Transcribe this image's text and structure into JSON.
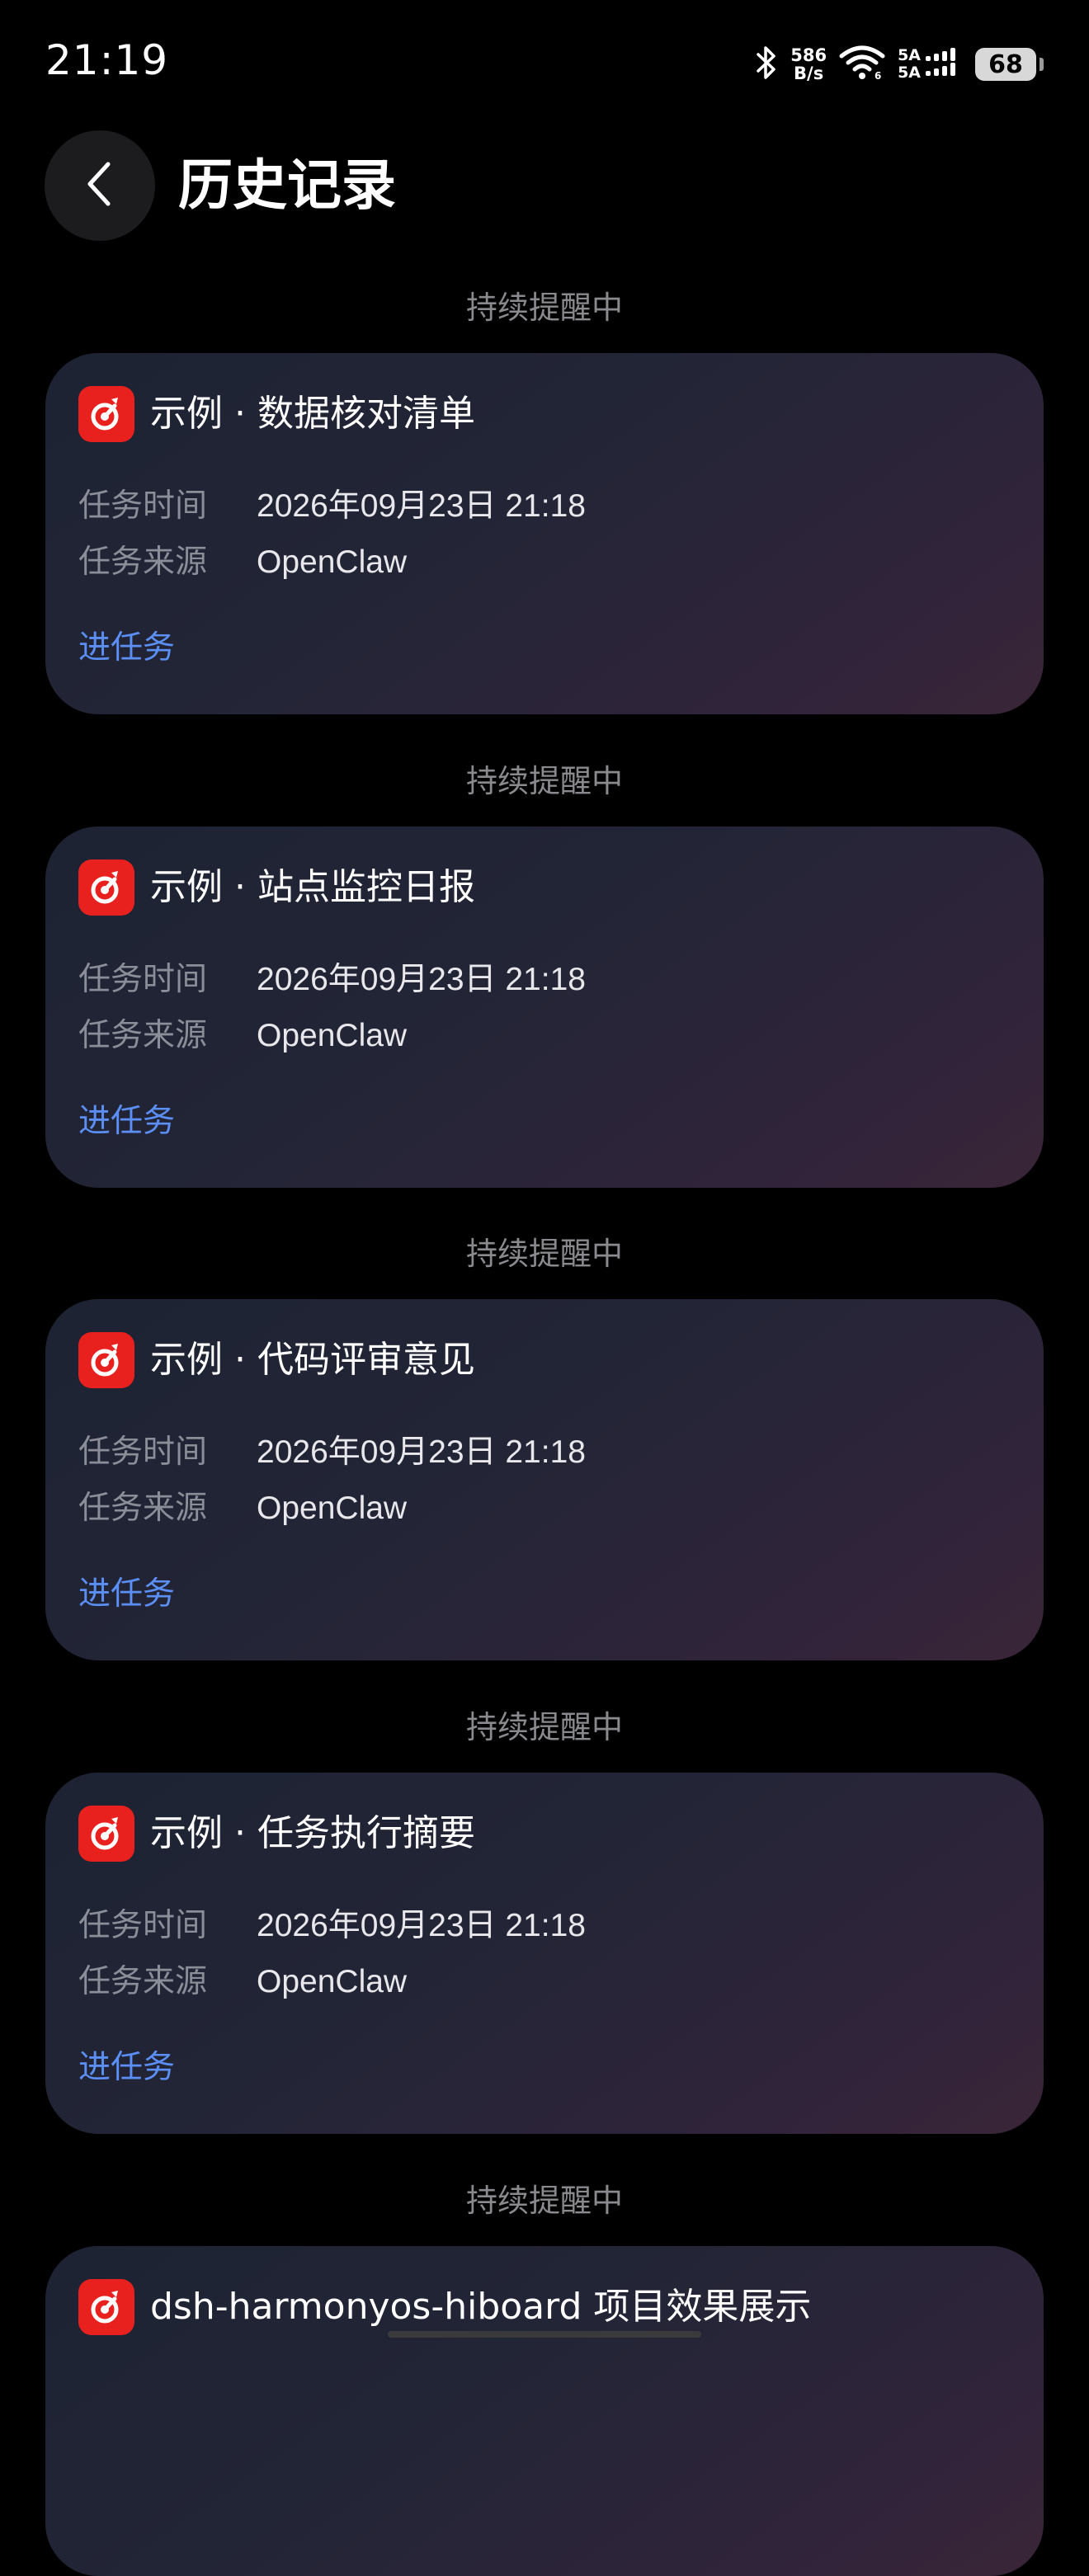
{
  "status_bar": {
    "time": "21:19",
    "net_speed_value": "586",
    "net_speed_unit": "B/s",
    "sim1": "5A",
    "sim2": "5A",
    "battery": "68",
    "icons": [
      "bluetooth-icon",
      "wifi-icon",
      "signal-icon",
      "battery-icon"
    ]
  },
  "header": {
    "title": "历史记录",
    "back_icon": "chevron-left-icon"
  },
  "labels": {
    "time_label": "任务时间",
    "source_label": "任务来源",
    "enter_task": "进任务"
  },
  "cards": [
    {
      "status": "持续提醒中",
      "title": "示例 · 数据核对清单",
      "time": "2026年09月23日 21:18",
      "source": "OpenClaw"
    },
    {
      "status": "持续提醒中",
      "title": "示例 · 站点监控日报",
      "time": "2026年09月23日 21:18",
      "source": "OpenClaw"
    },
    {
      "status": "持续提醒中",
      "title": "示例 · 代码评审意见",
      "time": "2026年09月23日 21:18",
      "source": "OpenClaw"
    },
    {
      "status": "持续提醒中",
      "title": "示例 · 任务执行摘要",
      "time": "2026年09月23日 21:18",
      "source": "OpenClaw"
    },
    {
      "status": "持续提醒中",
      "title": "dsh-harmonyos-hiboard 项目效果展示"
    }
  ],
  "colors": {
    "background": "#000000",
    "link": "#5c8ff5",
    "app_icon": "#e8211f",
    "muted": "#8a8a8e"
  }
}
